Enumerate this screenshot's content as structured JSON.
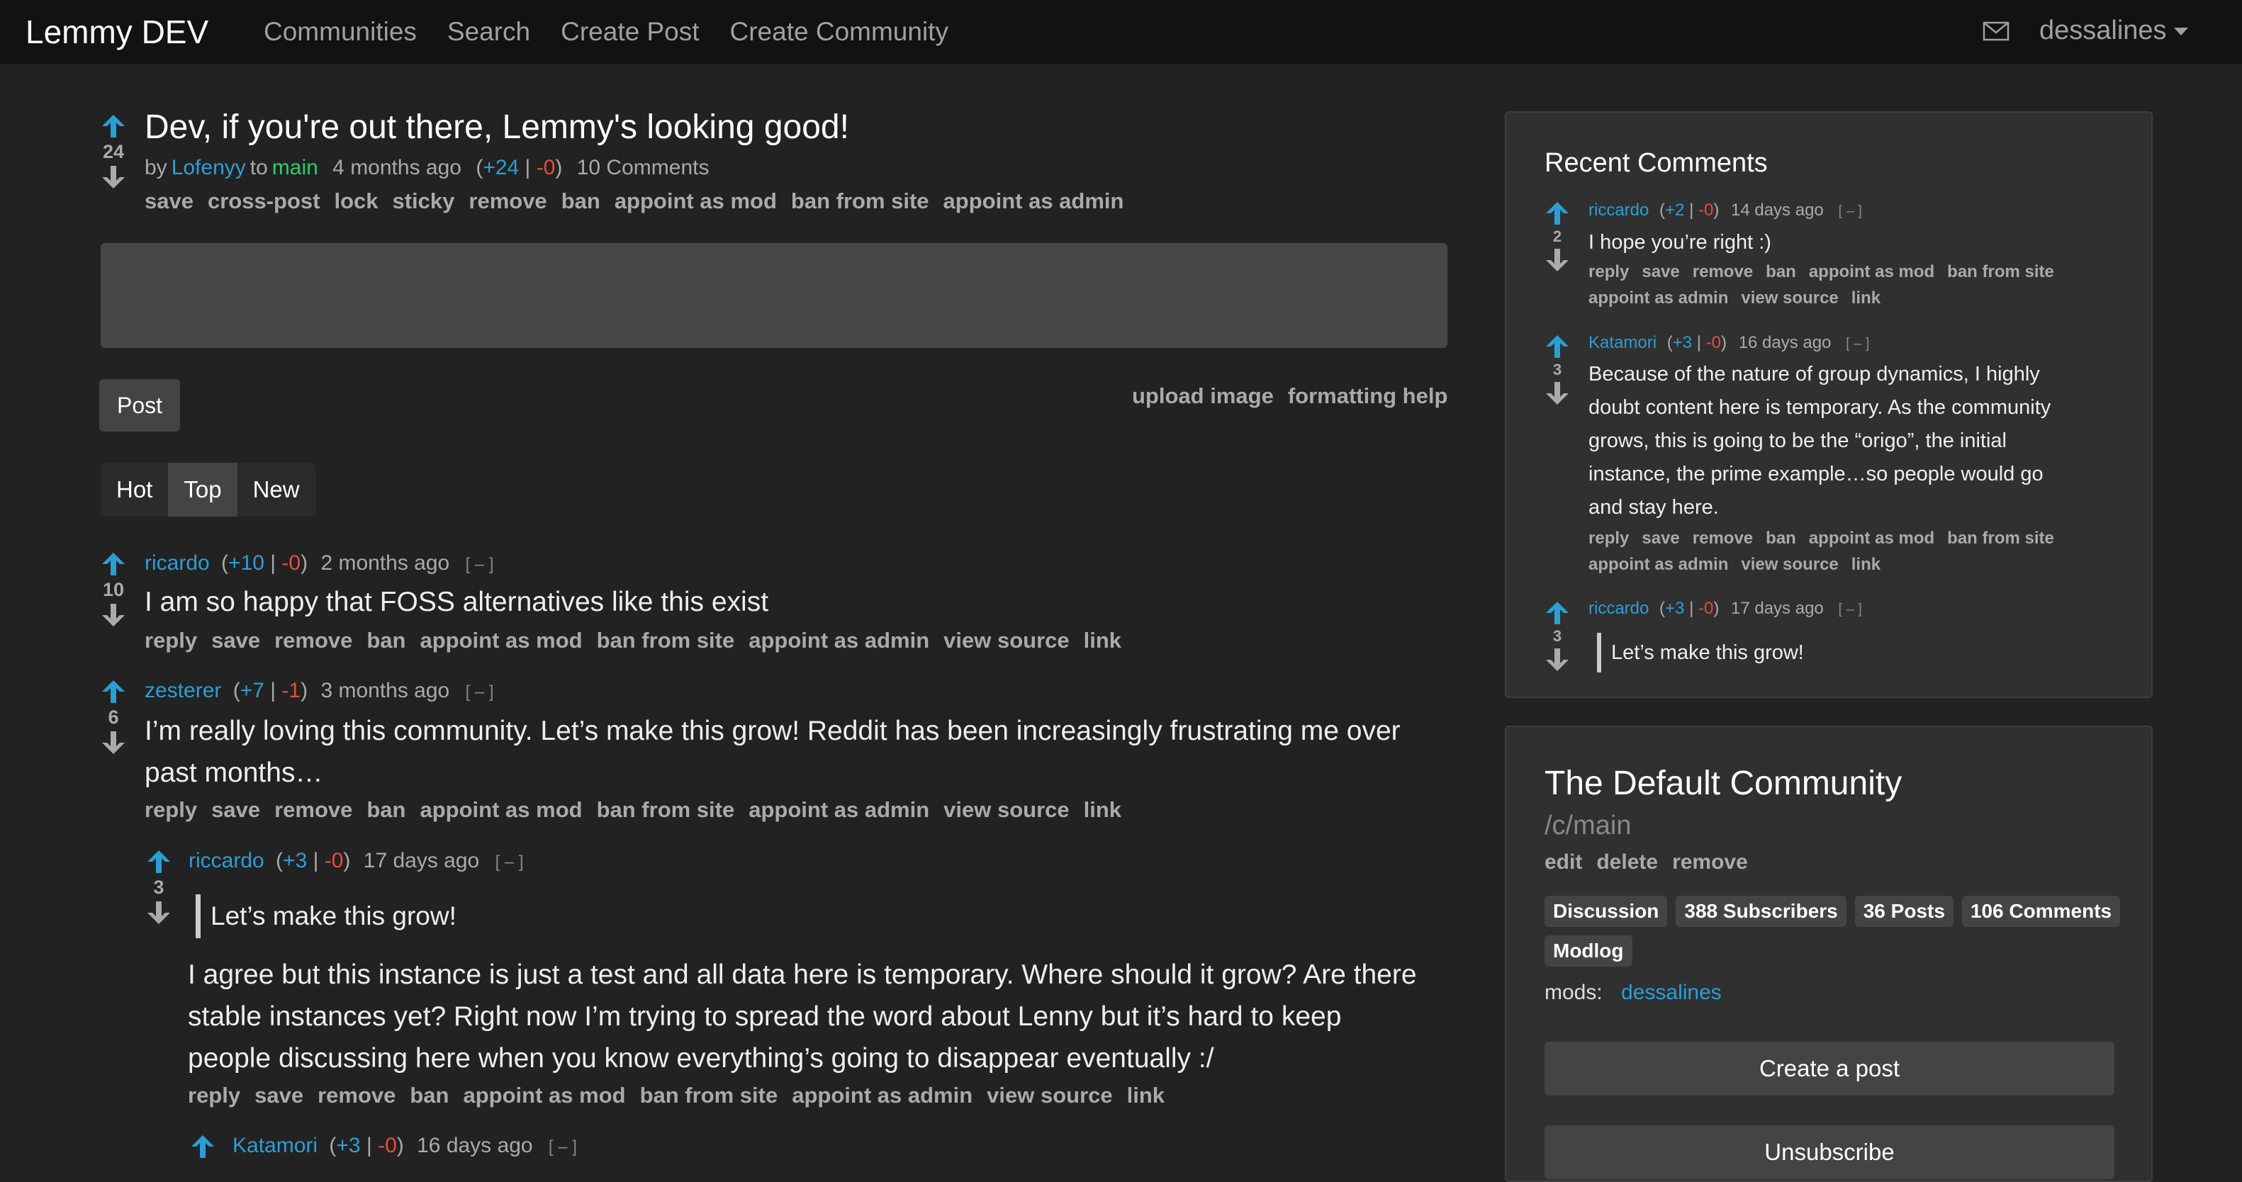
{
  "navbar": {
    "brand": "Lemmy DEV",
    "links": [
      "Communities",
      "Search",
      "Create Post",
      "Create Community"
    ],
    "mail_icon": "envelope-icon",
    "username": "dessalines"
  },
  "post": {
    "title": "Dev, if you're out there, Lemmy's looking good!",
    "score": "24",
    "by": "by",
    "author": "Lofenyy",
    "to": "to",
    "community": "main",
    "time": "4 months ago",
    "votes_open": "(",
    "upvotes": "+24",
    "votes_sep": "|",
    "downvotes": "-0",
    "votes_close": ")",
    "comment_count": "10 Comments",
    "actions": [
      "save",
      "cross-post",
      "lock",
      "sticky",
      "remove",
      "ban",
      "appoint as mod",
      "ban from site",
      "appoint as admin"
    ]
  },
  "editor": {
    "submit_label": "Post",
    "upload_label": "upload image",
    "help_label": "formatting help"
  },
  "sort": {
    "options": [
      "Hot",
      "Top",
      "New"
    ],
    "active": "Top"
  },
  "comment_actions": [
    "reply",
    "save",
    "remove",
    "ban",
    "appoint as mod",
    "ban from site",
    "appoint as admin",
    "view source",
    "link"
  ],
  "comments": [
    {
      "author": "ricardo",
      "upvotes": "+10",
      "downvotes": "-0",
      "time": "2 months ago",
      "score": "10",
      "collapse": "[ – ]",
      "text": "I am so happy that FOSS alternatives like this exist"
    },
    {
      "author": "zesterer",
      "upvotes": "+7",
      "downvotes": "-1",
      "time": "3 months ago",
      "score": "6",
      "collapse": "[ – ]",
      "text_line1": "I’m really loving this community. Let’s make this grow! Reddit has been increasingly frustrating me over",
      "text_line2": "past months…"
    },
    {
      "author": "riccardo",
      "upvotes": "+3",
      "downvotes": "-0",
      "time": "17 days ago",
      "score": "3",
      "collapse": "[ – ]",
      "quote": "Let’s make this grow!",
      "text_line1": "I agree but this instance is just a test and all data here is temporary. Where should it grow? Are there",
      "text_line2": "stable instances yet? Right now I’m trying to spread the word about Lenny but it’s hard to keep",
      "text_line3": "people discussing here when you know everything’s going to disappear eventually :/"
    },
    {
      "author": "Katamori",
      "upvotes": "+3",
      "downvotes": "-0",
      "time": "16 days ago",
      "collapse": "[ – ]"
    }
  ],
  "recent_comments": {
    "title": "Recent Comments",
    "actions_line1": [
      "reply",
      "save",
      "remove",
      "ban",
      "appoint as mod",
      "ban from site"
    ],
    "actions_line2": [
      "appoint as admin",
      "view source",
      "link"
    ],
    "items": [
      {
        "author": "riccardo",
        "upvotes": "+2",
        "downvotes": "-0",
        "time": "14 days ago",
        "score": "2",
        "collapse": "[ – ]",
        "text": "I hope you’re right :)"
      },
      {
        "author": "Katamori",
        "upvotes": "+3",
        "downvotes": "-0",
        "time": "16 days ago",
        "score": "3",
        "collapse": "[ – ]",
        "lines": [
          "Because of the nature of group dynamics, I highly",
          "doubt content here is temporary. As the community",
          "grows, this is going to be the “origo”, the initial",
          "instance, the prime example…so people would go",
          "and stay here."
        ]
      },
      {
        "author": "riccardo",
        "upvotes": "+3",
        "downvotes": "-0",
        "time": "17 days ago",
        "score": "3",
        "collapse": "[ – ]",
        "quote": "Let’s make this grow!"
      }
    ]
  },
  "community": {
    "title": "The Default Community",
    "name": "/c/main",
    "actions": [
      "edit",
      "delete",
      "remove"
    ],
    "badges": [
      "Discussion",
      "388 Subscribers",
      "36 Posts",
      "106 Comments",
      "Modlog"
    ],
    "mods_label": "mods:",
    "mod": "dessalines",
    "create_post_label": "Create a post",
    "unsubscribe_label": "Unsubscribe"
  },
  "colors": {
    "background": "#222222",
    "navbar": "#121212",
    "link": "#2a9fd6",
    "community_link": "#2ecc71",
    "downvote": "#e74c3c",
    "upvote_arrow": "#2a9fd6",
    "card": "#303030"
  }
}
